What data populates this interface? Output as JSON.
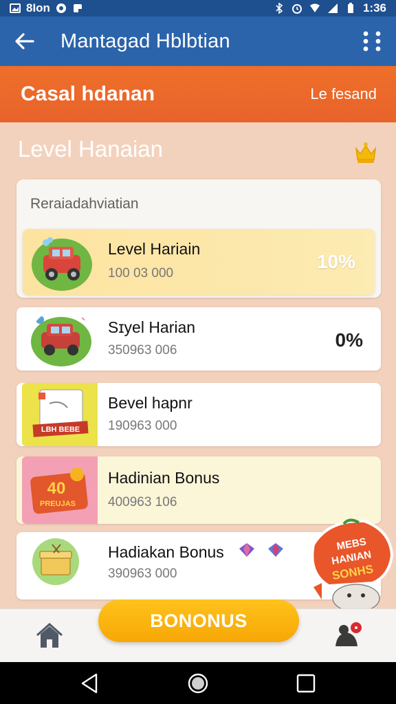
{
  "status_bar": {
    "left_text": "8Ion",
    "time": "1:36"
  },
  "app_bar": {
    "title": "Mantagad Hblbtian"
  },
  "orange_bar": {
    "title": "Casal hdanan",
    "right_text": "Le fesand"
  },
  "section": {
    "title": "Level Hanaian"
  },
  "panel": {
    "label": "Reraiadahviatian",
    "items": [
      {
        "title": "Level Hariain",
        "subtitle": "100 03 000",
        "percent": "10%"
      },
      {
        "title": "Sɪyel Harian",
        "subtitle": "350963 006",
        "percent": "0%"
      },
      {
        "title": "Bevel hapnr",
        "subtitle": "190963 000",
        "percent": ""
      },
      {
        "title": "Hadinian Bonus",
        "subtitle": "400963 106",
        "percent": "",
        "badge_number": "40",
        "badge_text": "PREUJAS"
      },
      {
        "title": "Hadiakan Bonus",
        "subtitle": "390963 000",
        "percent": ""
      }
    ]
  },
  "card3_banner_text": "LBH BEBE",
  "sticker": {
    "lines": [
      "MEBS",
      "HANIAN",
      "SONHS"
    ]
  },
  "bottom_nav": {
    "bonus_button": "BONONUS"
  },
  "colors": {
    "app_bar": "#2b64ab",
    "status_bar": "#1e4f8f",
    "orange": "#ea672a",
    "background": "#f3d2bd",
    "bonus": "#f9ad0c",
    "highlight_row": "#fde9a6"
  },
  "icons": {
    "back": "arrow-left-icon",
    "more": "more-vert-icon",
    "crown": "crown-icon",
    "home": "home-icon",
    "profile": "profile-notification-icon"
  }
}
